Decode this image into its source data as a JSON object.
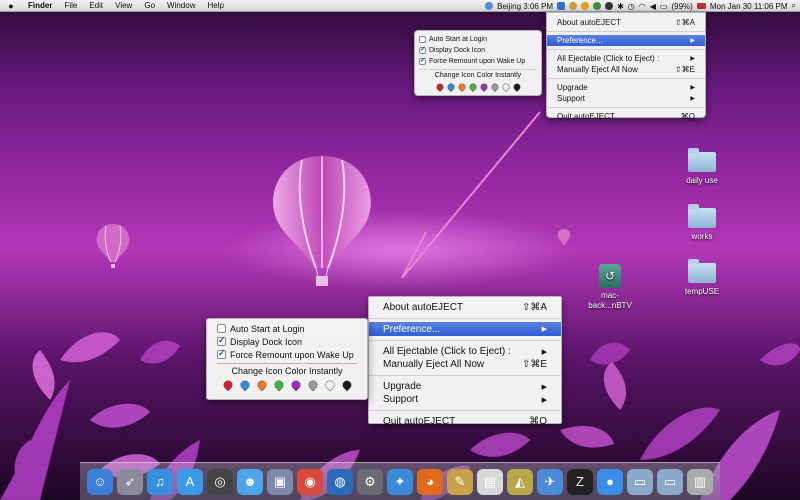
{
  "menubar": {
    "app": "Finder",
    "items": [
      "File",
      "Edit",
      "View",
      "Go",
      "Window",
      "Help"
    ],
    "clock_city": "Beijing 3:06 PM",
    "battery": "(99%)",
    "datetime": "Mon Jan 30  11:06 PM"
  },
  "menu": {
    "about": "About autoEJECT",
    "about_shortcut": "⇧⌘A",
    "preference": "Preference...",
    "all_ejectable": "All Ejectable (Click to Eject) :",
    "manual_eject": "Manually Eject All Now",
    "manual_shortcut": "⇧⌘E",
    "upgrade": "Upgrade",
    "support": "Support",
    "quit": "Quit autoEJECT",
    "quit_shortcut": "⌘Q",
    "submenu_arrow": "▶"
  },
  "submenu": {
    "auto_start": "Auto Start at Login",
    "display_dock": "Display Dock Icon",
    "force_remount": "Force Remount upon Wake Up",
    "change_color": "Change Icon Color Instantly",
    "auto_start_checked": false,
    "display_dock_checked": true,
    "force_remount_checked": true,
    "icon_colors": [
      "#d0202a",
      "#2f8de0",
      "#f07a1a",
      "#3aba3a",
      "#9a2ab8",
      "#9a9a9a",
      "#f0f0f0",
      "#1a1a1a"
    ]
  },
  "desktop": {
    "icons": [
      {
        "label": "daily use",
        "type": "folder"
      },
      {
        "label": "works",
        "type": "folder"
      },
      {
        "label": "tempUSE",
        "type": "folder"
      },
      {
        "label": "mac-\nback...nBTV",
        "type": "timemachine"
      }
    ]
  },
  "dock": {
    "items": [
      {
        "name": "finder",
        "color": "#3a7fd8",
        "glyph": "☺"
      },
      {
        "name": "rocket",
        "color": "#8a8a98",
        "glyph": "➶"
      },
      {
        "name": "itunes",
        "color": "#3a8ee0",
        "glyph": "♫"
      },
      {
        "name": "app-store",
        "color": "#3a9ae8",
        "glyph": "A"
      },
      {
        "name": "dashboard",
        "color": "#444",
        "glyph": "◎"
      },
      {
        "name": "messenger",
        "color": "#4aa6e8",
        "glyph": "☻"
      },
      {
        "name": "preview",
        "color": "#7a8aa8",
        "glyph": "▣"
      },
      {
        "name": "chrome",
        "color": "#d84a3a",
        "glyph": "◉"
      },
      {
        "name": "earth",
        "color": "#2a6ab8",
        "glyph": "◍"
      },
      {
        "name": "system-prefs",
        "color": "#6a6a72",
        "glyph": "⚙"
      },
      {
        "name": "safari",
        "color": "#3a8ad8",
        "glyph": "✦"
      },
      {
        "name": "firefox",
        "color": "#e06a1a",
        "glyph": "◕"
      },
      {
        "name": "xcode",
        "color": "#c8a24a",
        "glyph": "✎"
      },
      {
        "name": "documents",
        "color": "#d8d8d8",
        "glyph": "▤"
      },
      {
        "name": "sketch",
        "color": "#b8a84a",
        "glyph": "◭"
      },
      {
        "name": "code",
        "color": "#4a8ad8",
        "glyph": "✈"
      },
      {
        "name": "zen",
        "color": "#222",
        "glyph": "Z"
      },
      {
        "name": "droplet",
        "color": "#3a8ee8",
        "glyph": "●"
      },
      {
        "name": "stacks",
        "color": "#8aa8c8",
        "glyph": "▭"
      },
      {
        "name": "downloads",
        "color": "#8aa8c8",
        "glyph": "▭"
      },
      {
        "name": "trash",
        "color": "#aaa",
        "glyph": "▥"
      }
    ]
  }
}
